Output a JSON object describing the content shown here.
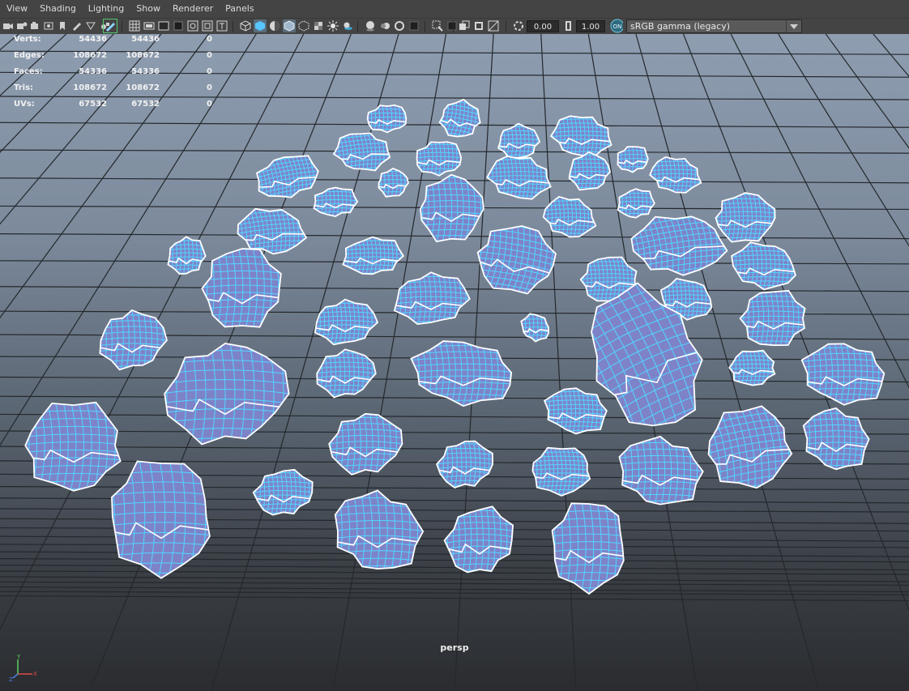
{
  "menu": [
    "View",
    "Shading",
    "Lighting",
    "Show",
    "Renderer",
    "Panels"
  ],
  "toolbar": {
    "exposure": "0.00",
    "gamma": "1.00",
    "colorspace_toggle": "ON",
    "colorspace": "sRGB gamma (legacy)"
  },
  "hud": {
    "rows": [
      {
        "label": "Verts:",
        "v1": "54436",
        "v2": "54436",
        "v3": "0"
      },
      {
        "label": "Edges:",
        "v1": "108672",
        "v2": "108672",
        "v3": "0"
      },
      {
        "label": "Faces:",
        "v1": "54336",
        "v2": "54336",
        "v3": "0"
      },
      {
        "label": "Tris:",
        "v1": "108672",
        "v2": "108672",
        "v3": "0"
      },
      {
        "label": "UVs:",
        "v1": "67532",
        "v2": "67532",
        "v3": "0"
      }
    ]
  },
  "camera_label": "persp",
  "colors": {
    "rock_fill": "#7e83c8",
    "rock_wire": "#52d6ff",
    "seam": "#ffffff",
    "grid": "#24282c"
  }
}
